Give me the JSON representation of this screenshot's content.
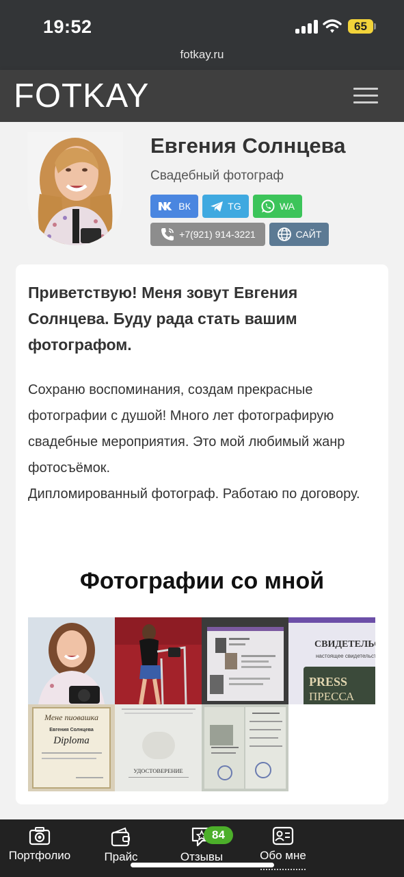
{
  "status_bar": {
    "time": "19:52",
    "url": "fotkay.ru",
    "battery": "65",
    "battery_color": "#f2d33a"
  },
  "header": {
    "logo": "FOTKAY",
    "menu_icon": "hamburger-menu-icon"
  },
  "profile": {
    "name": "Евгения Солнцева",
    "role": "Свадебный фотограф",
    "buttons": [
      {
        "label": "ВК",
        "icon": "vk-icon",
        "color": "#4a86e0"
      },
      {
        "label": "TG",
        "icon": "telegram-icon",
        "color": "#3fa9e0"
      },
      {
        "label": "WA",
        "icon": "whatsapp-icon",
        "color": "#3cc45a"
      },
      {
        "label": "+7(921) 914-3221",
        "icon": "phone-icon",
        "color": "#8d8d8d"
      },
      {
        "label": "САЙТ",
        "icon": "globe-icon",
        "color": "#5c7a94"
      }
    ]
  },
  "card": {
    "greeting": "Приветствую! Меня зовут Евгения Солнцева. Буду рада стать вашим фотографом.",
    "about_lines": [
      "Сохраню воспоминания, создам прекрасные фотографии с душой! Много лет фотографирую свадебные мероприятия. Это мой любимый жанр фотосъёмок.",
      "Дипломированный фотограф. Работаю по договору."
    ],
    "gallery_title": "Фотографии со мной",
    "gallery": [
      {
        "kind": "portrait-photo"
      },
      {
        "kind": "studio-photo"
      },
      {
        "kind": "certificate-photo"
      },
      {
        "kind": "press-certificate",
        "text_top": "СВИДЕТЕЛЬСТ",
        "text_sub": "настоящее свидетельство в",
        "text_press": "PRESS",
        "text_pressa": "ПРЕССА"
      },
      {
        "kind": "diploma",
        "text_top": "Мене пиовашка",
        "text_name": "Евгения Солнцева",
        "text_title": "Diploma"
      },
      {
        "kind": "udostoverenie",
        "text_main": "УДОСТОВЕРЕНИЕ"
      },
      {
        "kind": "document-photo"
      }
    ]
  },
  "tabbar": {
    "tabs": [
      {
        "label": "Портфолио",
        "icon": "camera-icon"
      },
      {
        "label": "Прайс",
        "icon": "wallet-icon"
      },
      {
        "label": "Отзывы",
        "icon": "reviews-star-icon"
      },
      {
        "label": "Обо мне",
        "icon": "id-card-icon"
      }
    ],
    "reviews_badge": "84",
    "badge_color": "#4caf2a"
  }
}
